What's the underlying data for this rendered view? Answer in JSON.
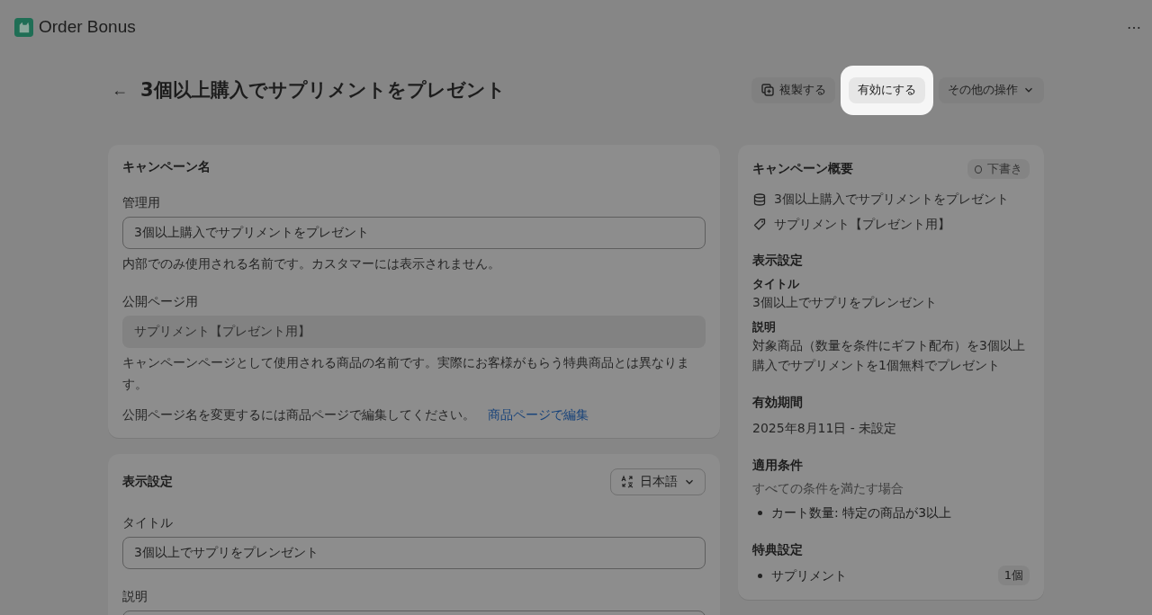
{
  "app": {
    "name": "Order Bonus",
    "more": "⋯"
  },
  "page": {
    "back": "←",
    "title": "3個以上購入でサプリメントをプレゼント"
  },
  "actions": [
    {
      "kind": "duplicate",
      "label": "複製する",
      "highlighted": false
    },
    {
      "kind": "plain",
      "label": "有効にする",
      "highlighted": true
    },
    {
      "kind": "menu",
      "label": "その他の操作",
      "highlighted": false
    }
  ],
  "campaign_name": {
    "heading": "キャンペーン名",
    "admin": {
      "label": "管理用",
      "value": "3個以上購入でサプリメントをプレゼント",
      "help": "内部でのみ使用される名前です。カスタマーには表示されません。"
    },
    "public": {
      "label": "公開ページ用",
      "value": "サプリメント【プレゼント用】",
      "disabled": true,
      "help": "キャンペーンページとして使用される商品の名前です。実際にお客様がもらう特典商品とは異なります。"
    },
    "note": "公開ページ名を変更するには商品ページで編集してください。",
    "link": "商品ページで編集"
  },
  "display": {
    "heading": "表示設定",
    "language": "日本語",
    "title": {
      "label": "タイトル",
      "value": "3個以上でサプリをプレンゼント"
    },
    "description": {
      "label": "説明"
    }
  },
  "summary": {
    "heading": "キャンペーン概要",
    "status": "下書き",
    "items": [
      {
        "kind": "database",
        "text": "3個以上購入でサプリメントをプレゼント"
      },
      {
        "kind": "tag",
        "text": "サプリメント【プレゼント用】"
      }
    ],
    "display_heading": "表示設定",
    "fields": [
      {
        "label": "タイトル",
        "value": "3個以上でサプリをプレンゼント"
      },
      {
        "label": "説明",
        "value": "対象商品（数量を条件にギフト配布）を3個以上購入でサプリメントを1個無料でプレゼント"
      }
    ],
    "period_heading": "有効期間",
    "period": "2025年8月11日 - 未設定",
    "conditions_heading": "適用条件",
    "conditions_note": "すべての条件を満たす場合",
    "conditions": [
      "カート数量: 特定の商品が3以上"
    ],
    "bonus_heading": "特典設定",
    "bonuses": [
      {
        "name": "サプリメント",
        "count": "1個"
      }
    ]
  }
}
